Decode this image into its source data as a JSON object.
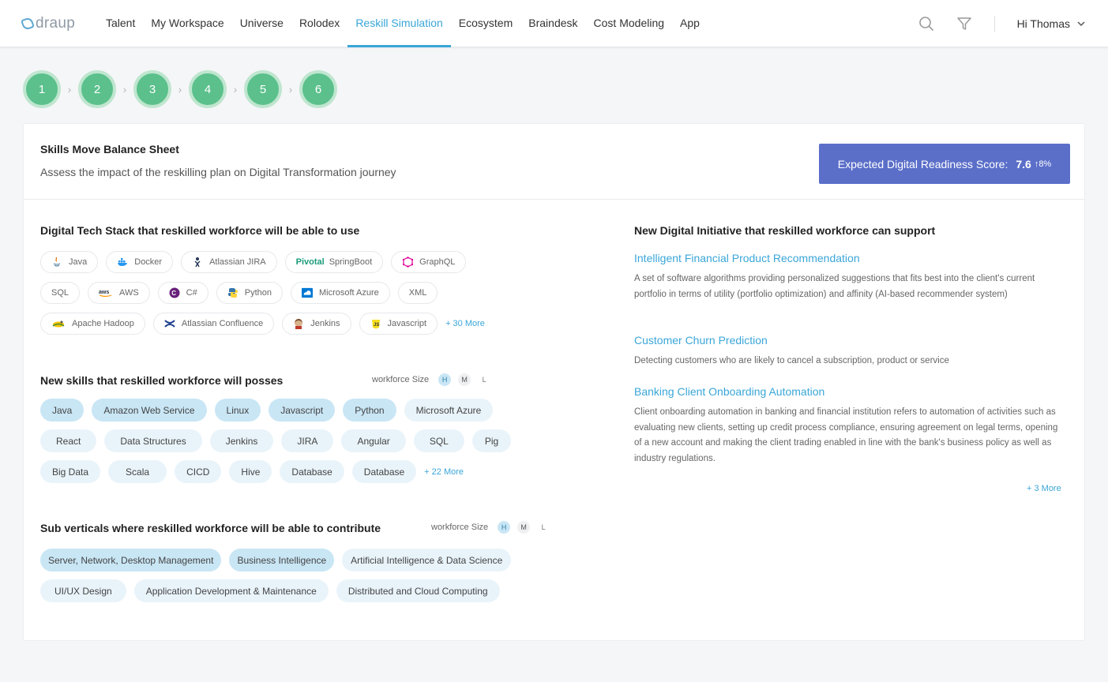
{
  "logo": "draup",
  "nav": [
    "Talent",
    "My Workspace",
    "Universe",
    "Rolodex",
    "Reskill Simulation",
    "Ecosystem",
    "Braindesk",
    "Cost Modeling",
    "App"
  ],
  "nav_active": 4,
  "user": "Hi Thomas",
  "steps": [
    "1",
    "2",
    "3",
    "4",
    "5",
    "6"
  ],
  "card": {
    "title": "Skills Move Balance Sheet",
    "subtitle": "Assess the impact of the reskilling plan on Digital Transformation journey",
    "score_label": "Expected Digital Readiness Score:",
    "score_value": "7.6",
    "score_change": "↑8%"
  },
  "tech_stack": {
    "title": "Digital Tech Stack that reskilled workforce will be able to use",
    "rows": [
      [
        {
          "label": "Java",
          "icon": "java-icon"
        },
        {
          "label": "Docker",
          "icon": "docker-icon"
        },
        {
          "label": "Atlassian JIRA",
          "icon": "jira-icon"
        },
        {
          "label": "SpringBoot",
          "prefix": "Pivotal",
          "icon": "pivotal-icon"
        },
        {
          "label": "GraphQL",
          "icon": "graphql-icon"
        }
      ],
      [
        {
          "label": "SQL",
          "icon": ""
        },
        {
          "label": "AWS",
          "icon": "aws-icon"
        },
        {
          "label": "C#",
          "icon": "csharp-icon"
        },
        {
          "label": "Python",
          "icon": "python-icon"
        },
        {
          "label": "Microsoft Azure",
          "icon": "azure-icon"
        },
        {
          "label": "XML",
          "icon": ""
        }
      ],
      [
        {
          "label": "Apache Hadoop",
          "icon": "hadoop-icon"
        },
        {
          "label": "Atlassian Confluence",
          "icon": "confluence-icon"
        },
        {
          "label": "Jenkins",
          "icon": "jenkins-icon"
        },
        {
          "label": "Javascript",
          "icon": "javascript-icon"
        }
      ]
    ],
    "more": "+ 30 More"
  },
  "new_skills": {
    "title": "New skills that reskilled workforce will posses",
    "workforce_label": "workforce Size",
    "sizes": [
      "H",
      "M",
      "L"
    ],
    "rows": [
      [
        {
          "label": "Java",
          "level": "hi"
        },
        {
          "label": "Amazon Web Service",
          "level": "hi"
        },
        {
          "label": "Linux",
          "level": "hi"
        },
        {
          "label": "Javascript",
          "level": "hi"
        },
        {
          "label": "Python",
          "level": "hi"
        },
        {
          "label": "Microsoft Azure",
          "level": "lo"
        }
      ],
      [
        {
          "label": "React",
          "level": "lo"
        },
        {
          "label": "Data Structures",
          "level": "lo"
        },
        {
          "label": "Jenkins",
          "level": "lo"
        },
        {
          "label": "JIRA",
          "level": "lo"
        },
        {
          "label": "Angular",
          "level": "lo"
        },
        {
          "label": "SQL",
          "level": "lo"
        },
        {
          "label": "Pig",
          "level": "lo"
        }
      ],
      [
        {
          "label": "Big Data",
          "level": "lo"
        },
        {
          "label": "Scala",
          "level": "lo"
        },
        {
          "label": "CICD",
          "level": "lo"
        },
        {
          "label": "Hive",
          "level": "lo"
        },
        {
          "label": "Database",
          "level": "lo"
        },
        {
          "label": "Database",
          "level": "lo"
        }
      ]
    ],
    "more": "+ 22 More"
  },
  "sub_verticals": {
    "title": "Sub verticals where reskilled workforce will be able to contribute",
    "workforce_label": "workforce Size",
    "sizes": [
      "H",
      "M",
      "L"
    ],
    "rows": [
      [
        {
          "label": "Server, Network, Desktop Management",
          "level": "hi"
        },
        {
          "label": "Business Intelligence",
          "level": "hi"
        },
        {
          "label": "Artificial Intelligence & Data Science",
          "level": "lo"
        }
      ],
      [
        {
          "label": "UI/UX Design",
          "level": "lo"
        },
        {
          "label": "Application Development & Maintenance",
          "level": "lo"
        },
        {
          "label": "Distributed and Cloud Computing",
          "level": "lo"
        }
      ]
    ]
  },
  "initiatives": {
    "title": "New Digital Initiative that reskilled workforce can support",
    "items": [
      {
        "title": "Intelligent Financial Product Recommendation",
        "desc": "A set of software algorithms providing personalized suggestions that fits best into the client's current portfolio in terms of utility (portfolio optimization) and affinity (AI-based recommender system)"
      },
      {
        "title": "Customer Churn Prediction",
        "desc": "Detecting customers who are likely to cancel a subscription, product or service"
      },
      {
        "title": "Banking Client Onboarding Automation",
        "desc": "Client onboarding automation in banking and financial institution refers to automation of activities such as evaluating new clients, setting up credit process compliance, ensuring agreement on legal terms, opening of a new account and making the client trading enabled in line with the bank's business policy as well as industry regulations."
      }
    ],
    "more": "+ 3 More"
  },
  "colors": {
    "accent": "#3aa6d8",
    "step": "#5bc08c",
    "score_button": "#5b6fc9",
    "chip_high": "#c9e6f5",
    "chip_low": "#e9f4fa"
  }
}
